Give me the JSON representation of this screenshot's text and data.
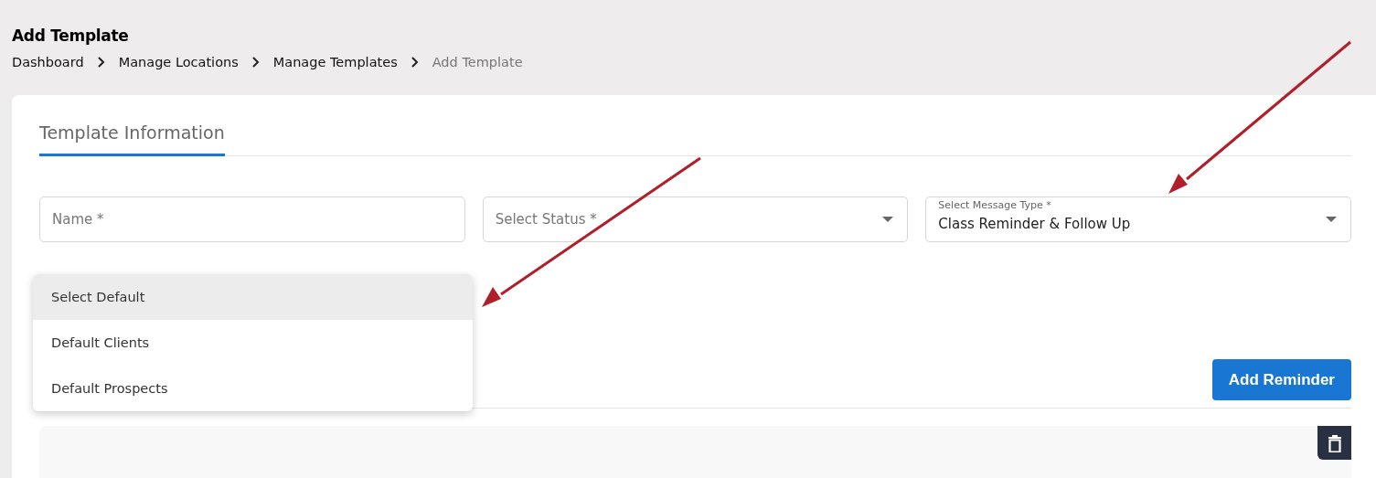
{
  "page_title": "Add Template",
  "breadcrumbs": [
    {
      "label": "Dashboard",
      "current": false
    },
    {
      "label": "Manage Locations",
      "current": false
    },
    {
      "label": "Manage Templates",
      "current": false
    },
    {
      "label": "Add Template",
      "current": true
    }
  ],
  "tabs": [
    {
      "label": "Template Information",
      "selected": true
    }
  ],
  "fields": [
    {
      "kind": "text",
      "placeholder": "Name *"
    },
    {
      "kind": "select",
      "placeholder": "Select Status *"
    },
    {
      "kind": "select",
      "label": "Select Message Type *",
      "value": "Class Reminder & Follow Up"
    }
  ],
  "default_menu": [
    {
      "label": "Select Default",
      "selected": true
    },
    {
      "label": "Default Clients",
      "selected": false
    },
    {
      "label": "Default Prospects",
      "selected": false
    }
  ],
  "add_button": "Add Reminder"
}
